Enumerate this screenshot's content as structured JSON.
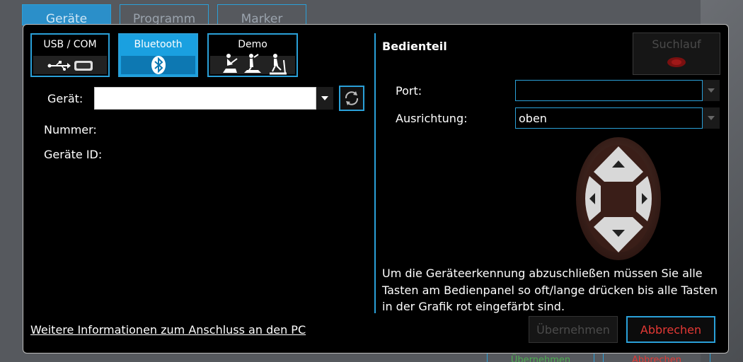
{
  "background": {
    "tabs": [
      "Geräte",
      "Programm",
      "Marker"
    ],
    "bottom_buttons": [
      "Übernehmen",
      "Abbrechen"
    ]
  },
  "connection_modes": [
    {
      "label": "USB / COM",
      "icon": "usb-serial-icon",
      "active": false
    },
    {
      "label": "Bluetooth",
      "icon": "bluetooth-icon",
      "active": true
    },
    {
      "label": "Demo",
      "icon": "fitness-devices-icon",
      "active": false
    }
  ],
  "device": {
    "label": "Gerät:",
    "value": "",
    "number_label": "Nummer:",
    "id_label": "Geräte ID:"
  },
  "panel": {
    "title": "Bedienteil",
    "search_label": "Suchlauf",
    "port_label": "Port:",
    "port_value": "",
    "orientation_label": "Ausrichtung:",
    "orientation_value": "oben",
    "info_text": "Um die Geräteerkennung abzuschließen müssen Sie alle Tasten am Bedienpanel so oft/lange drücken bis alle Tasten in der Grafik rot eingefärbt sind."
  },
  "footer": {
    "link_text": "Weitere Informationen zum Anschluss an den PC",
    "apply_label": "Übernehmen",
    "cancel_label": "Abbrechen"
  },
  "colors": {
    "accent": "#2aa0d8",
    "active_button": "#1aa0e0",
    "cancel_text": "#e53935"
  }
}
